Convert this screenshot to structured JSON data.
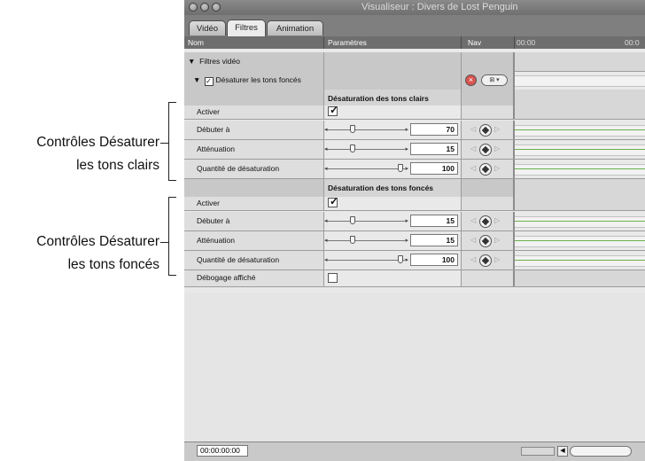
{
  "callouts": {
    "light": {
      "line1": "Contrôles Désaturer",
      "line2": "les tons clairs"
    },
    "dark": {
      "line1": "Contrôles Désaturer",
      "line2": "les tons foncés"
    }
  },
  "window": {
    "title": "Visualiseur : Divers de Lost Penguin",
    "tabs": [
      "Vidéo",
      "Filtres",
      "Animation"
    ],
    "active_tab": "Filtres"
  },
  "columns": {
    "name": "Nom",
    "params": "Paramètres",
    "nav": "Nav",
    "timeline": [
      "00:00",
      "00:0"
    ]
  },
  "filters": {
    "group_label": "Filtres vidéo",
    "filter_name": "Désaturer les tons foncés"
  },
  "sections": {
    "light": {
      "title": "Désaturation des tons clairs",
      "rows": [
        {
          "label": "Activer"
        },
        {
          "label": "Débuter à",
          "value": "70"
        },
        {
          "label": "Atténuation",
          "value": "15"
        },
        {
          "label": "Quantité de désaturation",
          "value": "100"
        }
      ]
    },
    "dark": {
      "title": "Désaturation des tons foncés",
      "rows": [
        {
          "label": "Activer"
        },
        {
          "label": "Débuter à",
          "value": "15"
        },
        {
          "label": "Atténuation",
          "value": "15"
        },
        {
          "label": "Quantité de désaturation",
          "value": "100"
        }
      ]
    },
    "debug": {
      "label": "Débogage affiché"
    }
  },
  "status": {
    "timecode": "00:00:00:00"
  },
  "colors": {
    "keyframe_line": "#6ab04c",
    "title_bar": "#7a7a7a"
  }
}
